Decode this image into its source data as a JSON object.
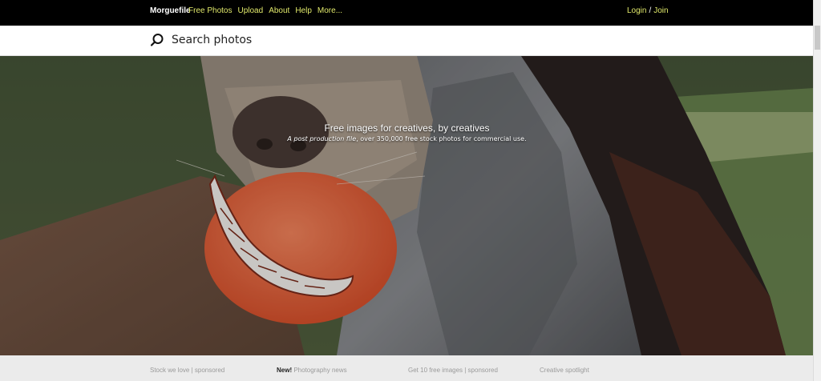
{
  "nav": {
    "brand": "Morguefile",
    "links": [
      {
        "label": "Free Photos"
      },
      {
        "label": "Upload"
      },
      {
        "label": "About"
      },
      {
        "label": "Help"
      },
      {
        "label": "More..."
      }
    ],
    "login": "Login",
    "separator": "/",
    "join": "Join"
  },
  "search": {
    "placeholder": "Search photos"
  },
  "hero": {
    "headline": "Free images for creatives, by creatives",
    "sub_italic": "A post production file",
    "sub_rest": ", over 350,000 free stock photos for commercial use."
  },
  "footer": {
    "item1": "Stock we love | sponsored",
    "item2_bold": "New!",
    "item2_rest": " Photography news",
    "item3": "Get 10 free images | sponsored",
    "item4": "Creative spotlight"
  },
  "colors": {
    "nav_background": "#000000",
    "nav_link": "#e1e96b",
    "footer_background": "#ebebeb"
  }
}
